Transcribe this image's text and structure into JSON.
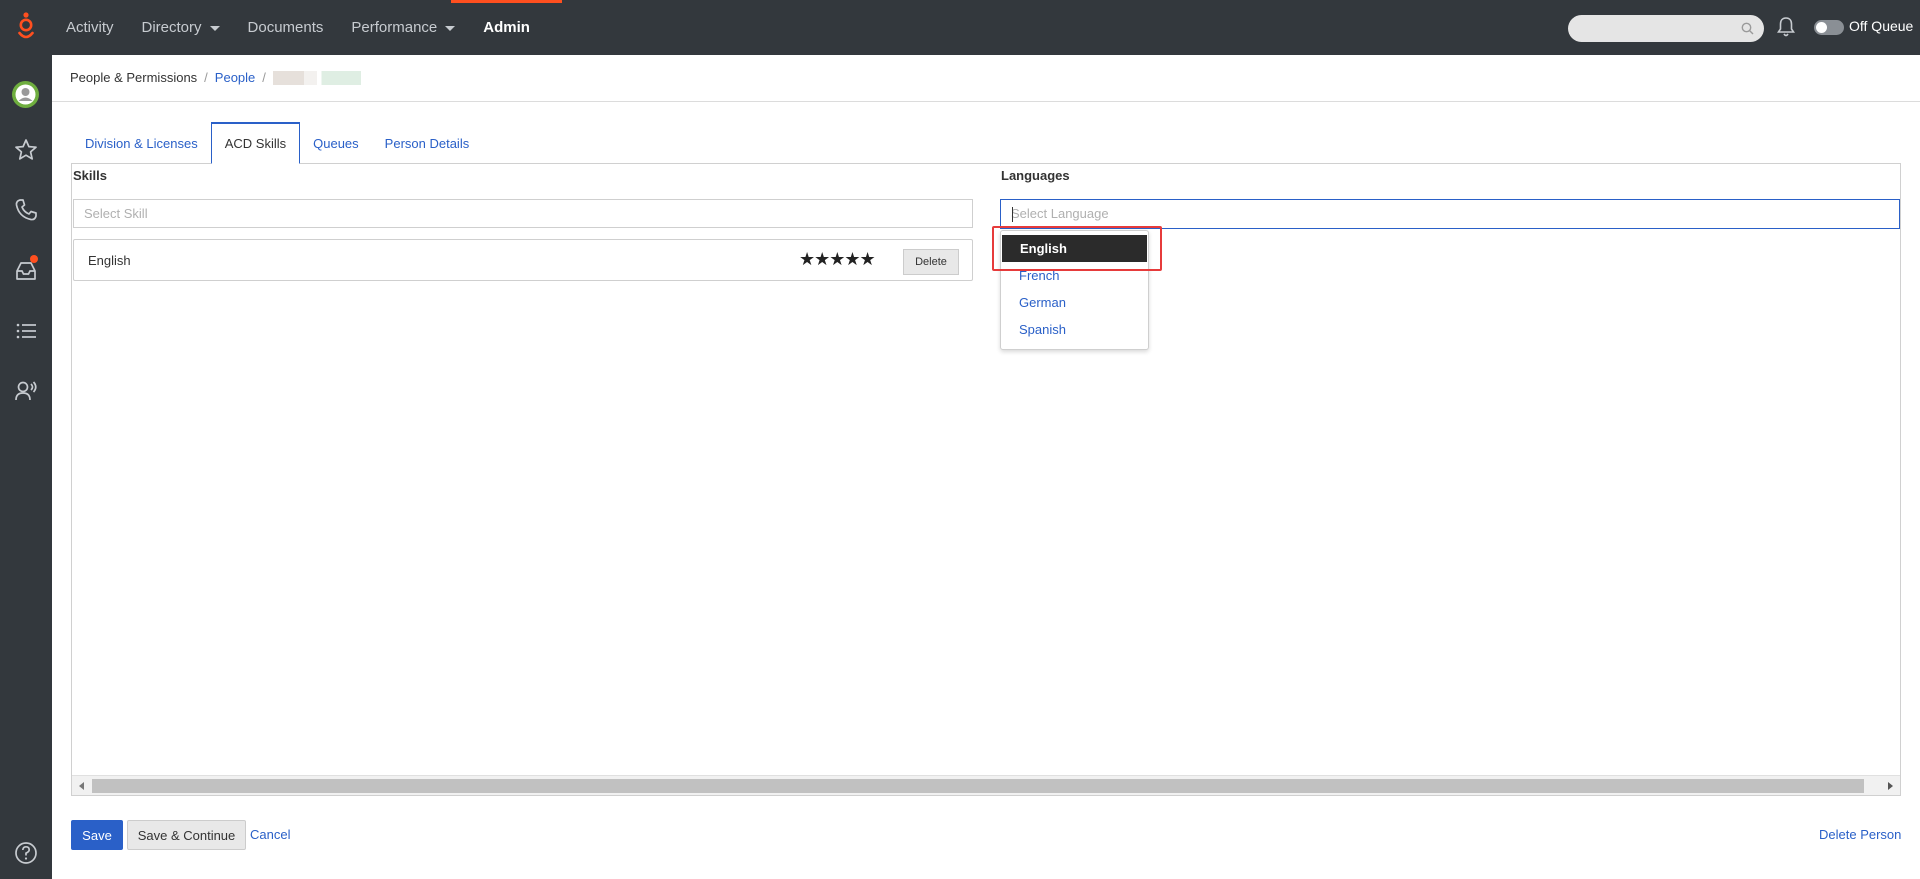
{
  "topbar": {
    "nav": [
      {
        "label": "Activity",
        "has_caret": false,
        "active": false
      },
      {
        "label": "Directory",
        "has_caret": true,
        "active": false
      },
      {
        "label": "Documents",
        "has_caret": false,
        "active": false
      },
      {
        "label": "Performance",
        "has_caret": true,
        "active": false
      },
      {
        "label": "Admin",
        "has_caret": false,
        "active": true
      }
    ],
    "search": {
      "placeholder": ""
    },
    "status_label": "Off Queue"
  },
  "sidebar": {
    "icons": [
      "avatar",
      "star-icon",
      "phone-icon",
      "inbox-icon",
      "list-icon",
      "agent-icon",
      "help-icon"
    ]
  },
  "breadcrumb": {
    "root": "People & Permissions",
    "people": "People"
  },
  "tabs": [
    {
      "label": "Division & Licenses",
      "active": false
    },
    {
      "label": "ACD Skills",
      "active": true
    },
    {
      "label": "Queues",
      "active": false
    },
    {
      "label": "Person Details",
      "active": false
    }
  ],
  "skills": {
    "title": "Skills",
    "placeholder": "Select Skill",
    "items": [
      {
        "name": "English",
        "stars": "★★★★★",
        "rating": 5,
        "delete_label": "Delete"
      }
    ]
  },
  "languages": {
    "title": "Languages",
    "placeholder": "Select Language",
    "options": [
      {
        "label": "English",
        "selected": true
      },
      {
        "label": "French",
        "selected": false
      },
      {
        "label": "German",
        "selected": false
      },
      {
        "label": "Spanish",
        "selected": false
      }
    ]
  },
  "footer": {
    "save": "Save",
    "save_continue": "Save & Continue",
    "cancel": "Cancel",
    "delete_person": "Delete Person"
  },
  "colors": {
    "topbar": "#33383d",
    "accent": "#ff4f1f",
    "link": "#2a60c8",
    "highlight": "#e63b3b"
  }
}
